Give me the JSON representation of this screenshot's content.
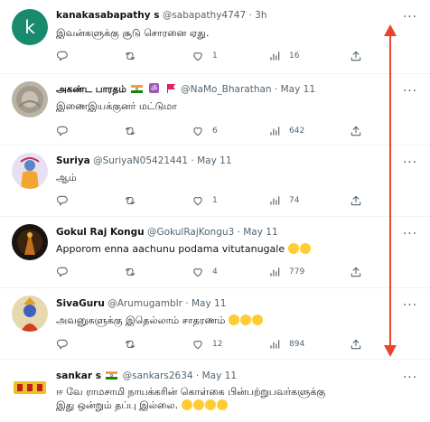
{
  "tweets": [
    {
      "name": "kanakasabapathy s",
      "handle": "@sabapathy4747",
      "time": "3h",
      "text": "இவன்களுக்கு சூடு சொரனை ஏது.",
      "replies": "",
      "retweets": "",
      "likes": "1",
      "views": "16",
      "avatar_letter": "k",
      "avatar_color": "#1a8a6e"
    },
    {
      "name": "அகண்ட பாரதம்",
      "handle": "@NaMo_Bharathan",
      "time": "May 11",
      "text": "இணைஇயக்குனர் மட்டுமா",
      "replies": "",
      "retweets": "",
      "likes": "6",
      "views": "642"
    },
    {
      "name": "Suriya",
      "handle": "@SuriyaN05421441",
      "time": "May 11",
      "text": "ஆம்",
      "replies": "",
      "retweets": "",
      "likes": "1",
      "views": "74"
    },
    {
      "name": "Gokul Raj Kongu",
      "handle": "@GokulRajKongu3",
      "time": "May 11",
      "text": "Apporom enna aachunu podama vitutanugale",
      "replies": "",
      "retweets": "",
      "likes": "4",
      "views": "779"
    },
    {
      "name": "SivaGuru",
      "handle": "@Arumugamblr",
      "time": "May 11",
      "text": "அவனுகளுக்கு இதெல்லாம் சாதரணம்",
      "replies": "",
      "retweets": "",
      "likes": "12",
      "views": "894"
    },
    {
      "name": "sankar s",
      "handle": "@sankars2634",
      "time": "May 11",
      "text": "ஈ வே ராமசாமி நாயக்கரின் கொள்கை பின்பற்றுபவர்களுக்கு",
      "text2": "இது ஒன்றும் தப்பு இல்லை."
    }
  ],
  "separator": "·",
  "colors": {
    "accent_arrow": "#e8452c",
    "muted": "#536471",
    "divider": "#eff3f4"
  },
  "icons": [
    "reply-icon",
    "retweet-icon",
    "like-icon",
    "views-icon",
    "share-icon",
    "more-icon"
  ]
}
